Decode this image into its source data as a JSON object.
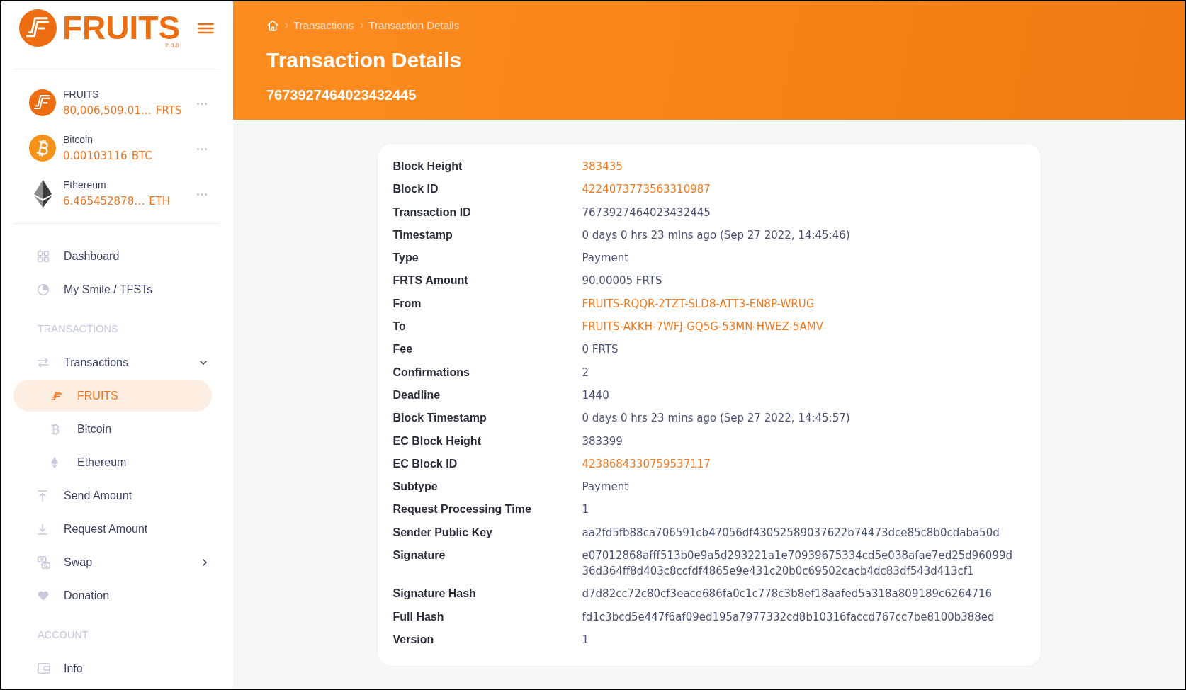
{
  "sidebar": {
    "brand": {
      "name": "FRUITS",
      "version": "2.0.0"
    },
    "wallets": [
      {
        "name": "FRUITS",
        "amount": "80,006,509.01…",
        "unit": "FRTS"
      },
      {
        "name": "Bitcoin",
        "amount": "0.00103116",
        "unit": "BTC"
      },
      {
        "name": "Ethereum",
        "amount": "6.465452878…",
        "unit": "ETH"
      }
    ],
    "nav": [
      {
        "kind": "item",
        "label": "Dashboard",
        "selected": false
      },
      {
        "kind": "item",
        "label": "My Smile / TFSTs",
        "selected": false
      },
      {
        "kind": "section",
        "label": "TRANSACTIONS"
      },
      {
        "kind": "item",
        "label": "Transactions",
        "selected": false,
        "expanded": true,
        "children": [
          {
            "label": "FRUITS",
            "selected": true
          },
          {
            "label": "Bitcoin",
            "selected": false
          },
          {
            "label": "Ethereum",
            "selected": false
          }
        ]
      },
      {
        "kind": "item",
        "label": "Send Amount",
        "selected": false
      },
      {
        "kind": "item",
        "label": "Request Amount",
        "selected": false
      },
      {
        "kind": "item",
        "label": "Swap",
        "selected": false,
        "expanded": false
      },
      {
        "kind": "item",
        "label": "Donation",
        "selected": false
      },
      {
        "kind": "section",
        "label": "ACCOUNT"
      },
      {
        "kind": "item",
        "label": "Info",
        "selected": false
      }
    ]
  },
  "header": {
    "breadcrumbs": [
      "Transactions",
      "Transaction Details"
    ],
    "title": "Transaction Details",
    "subtitle": "7673927464023432445"
  },
  "details": {
    "rows": [
      {
        "label": "Block Height",
        "value": "383435",
        "link": true
      },
      {
        "label": "Block ID",
        "value": "4224073773563310987",
        "link": true
      },
      {
        "label": "Transaction ID",
        "value": "7673927464023432445",
        "link": false
      },
      {
        "label": "Timestamp",
        "value": "0 days 0 hrs 23 mins ago (Sep 27 2022, 14:45:46)",
        "link": false
      },
      {
        "label": "Type",
        "value": "Payment",
        "link": false
      },
      {
        "label": "FRTS Amount",
        "value": "90.00005 FRTS",
        "link": false
      },
      {
        "label": "From",
        "value": "FRUITS-RQQR-2TZT-SLD8-ATT3-EN8P-WRUG",
        "link": true
      },
      {
        "label": "To",
        "value": "FRUITS-AKKH-7WFJ-GQ5G-53MN-HWEZ-5AMV",
        "link": true
      },
      {
        "label": "Fee",
        "value": "0 FRTS",
        "link": false
      },
      {
        "label": "Confirmations",
        "value": "2",
        "link": false
      },
      {
        "label": "Deadline",
        "value": "1440",
        "link": false
      },
      {
        "label": "Block Timestamp",
        "value": "0 days 0 hrs 23 mins ago (Sep 27 2022, 14:45:57)",
        "link": false
      },
      {
        "label": "EC Block Height",
        "value": "383399",
        "link": false
      },
      {
        "label": "EC Block ID",
        "value": "4238684330759537117",
        "link": true
      },
      {
        "label": "Subtype",
        "value": "Payment",
        "link": false
      },
      {
        "label": "Request Processing Time",
        "value": "1",
        "link": false
      },
      {
        "label": "Sender Public Key",
        "value": "aa2fd5fb88ca706591cb47056df43052589037622b74473dce85c8b0cdaba50d",
        "link": false
      },
      {
        "label": "Signature",
        "value": "e07012868afff513b0e9a5d293221a1e70939675334cd5e038afae7ed25d96099d36d364ff8d403c8ccfdf4865e9e431c20b0c69502cacb4dc83df543d413cf1",
        "link": false
      },
      {
        "label": "Signature Hash",
        "value": "d7d82cc72c80cf3eace686fa0c1c778c3b8ef18aafed5a318a809189c6264716",
        "link": false
      },
      {
        "label": "Full Hash",
        "value": "fd1c3bcd5e447f6af09ed195a7977332cd8b10316faccd767cc7be8100b388ed",
        "link": false
      },
      {
        "label": "Version",
        "value": "1",
        "link": false
      }
    ]
  }
}
